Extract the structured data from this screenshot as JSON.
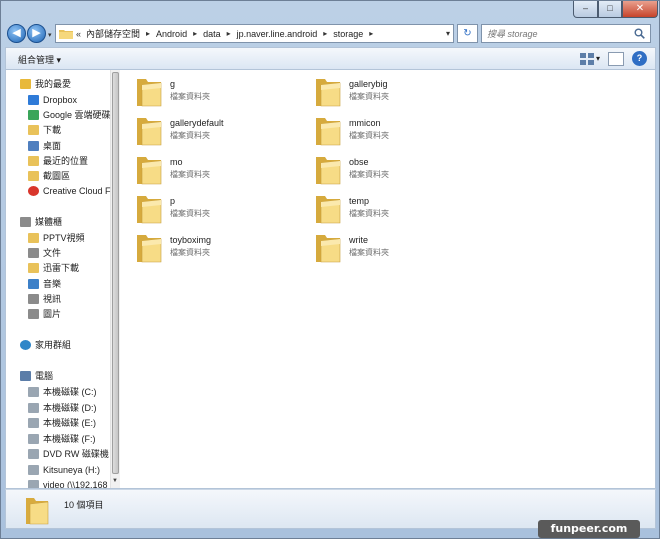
{
  "window": {
    "min_glyph": "‒",
    "max_glyph": "□",
    "close_glyph": "✕"
  },
  "nav": {
    "back_glyph": "◀",
    "forward_glyph": "▶",
    "history_glyph": "▾",
    "overflow": "«",
    "breadcrumb": [
      "內部儲存空間",
      "Android",
      "data",
      "jp.naver.line.android",
      "storage"
    ],
    "crumb_chevron": "▸",
    "dropdown_glyph": "▾",
    "refresh_glyph": "↻",
    "search_placeholder": "搜尋 storage"
  },
  "toolbar": {
    "organize": "組合管理 ▾",
    "views_glyph": "▾",
    "help_glyph": "?"
  },
  "sidebar": {
    "favorites": [
      "我的最愛",
      "Dropbox",
      "Google 雲端硬碟",
      "下載",
      "桌面",
      "最近的位置",
      "截圖區",
      "Creative Cloud F"
    ],
    "libraries": [
      "媒體櫃",
      "PPTV視頻",
      "文件",
      "迅雷下載",
      "音樂",
      "視訊",
      "圖片"
    ],
    "homegroup": "家用群組",
    "computer": [
      "電腦",
      "本機磁碟 (C:)",
      "本機磁碟 (D:)",
      "本機磁碟 (E:)",
      "本機磁碟 (F:)",
      "DVD RW 磁碟機",
      "Kitsuneya (H:)",
      "video (\\\\192.168"
    ],
    "scroll_down_glyph": "▼"
  },
  "files": [
    {
      "name": "g",
      "type": "檔案資料夾"
    },
    {
      "name": "gallerybig",
      "type": "檔案資料夾"
    },
    {
      "name": "gallerydefault",
      "type": "檔案資料夾"
    },
    {
      "name": "mmicon",
      "type": "檔案資料夾"
    },
    {
      "name": "mo",
      "type": "檔案資料夾"
    },
    {
      "name": "obse",
      "type": "檔案資料夾"
    },
    {
      "name": "p",
      "type": "檔案資料夾"
    },
    {
      "name": "temp",
      "type": "檔案資料夾"
    },
    {
      "name": "toyboximg",
      "type": "檔案資料夾"
    },
    {
      "name": "write",
      "type": "檔案資料夾"
    }
  ],
  "details": {
    "count": "10 個項目"
  },
  "watermark": "funpeer.com",
  "colors": {
    "frame": "#a9c1dd",
    "folder": "#f1cf6b",
    "accent": "#2f6ec4"
  }
}
